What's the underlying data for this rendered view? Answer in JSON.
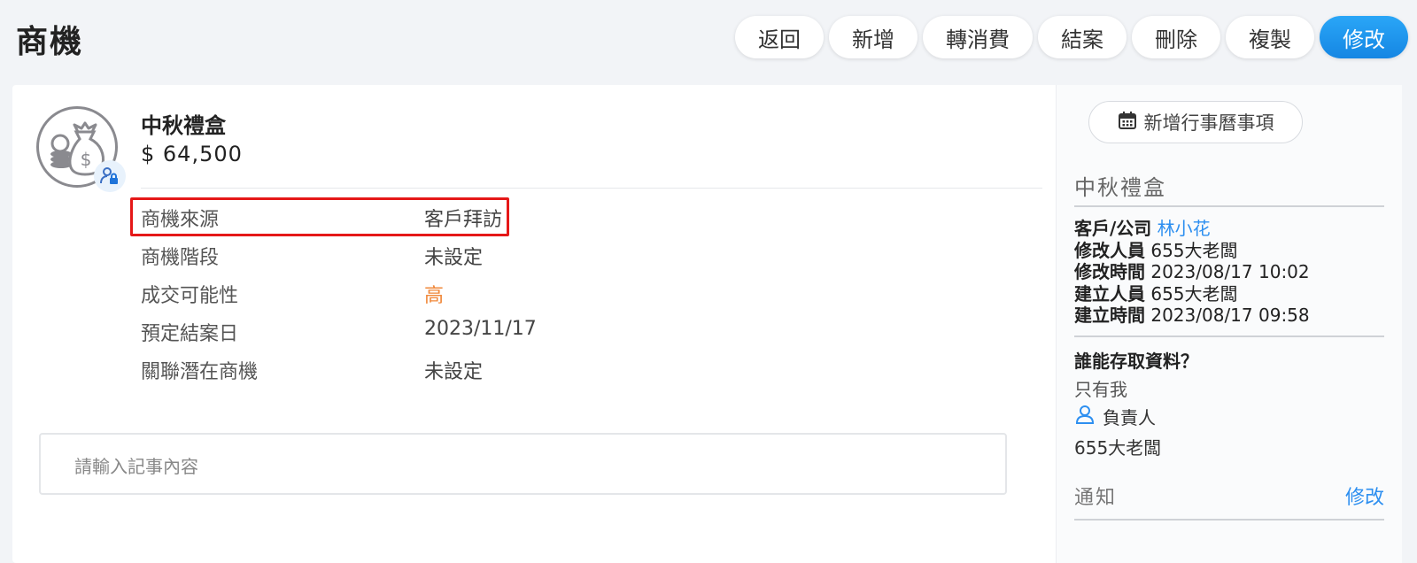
{
  "page": {
    "title": "商機"
  },
  "toolbar": {
    "buttons": [
      "返回",
      "新增",
      "轉消費",
      "結案",
      "刪除",
      "複製",
      "修改"
    ],
    "primary_color": "#1a8fe8"
  },
  "deal": {
    "name": "中秋禮盒",
    "amount": "$ 64,500",
    "fields": [
      {
        "label": "商機來源",
        "value": "客戶拜訪"
      },
      {
        "label": "商機階段",
        "value": "未設定"
      },
      {
        "label": "成交可能性",
        "value": "高"
      },
      {
        "label": "預定結案日",
        "value": "2023/11/17"
      },
      {
        "label": "關聯潛在商機",
        "value": "未設定"
      }
    ],
    "probability_color": "#f0883a"
  },
  "memo": {
    "placeholder": "請輸入記事內容"
  },
  "side": {
    "calendar_button": "新增行事曆事項",
    "title": "中秋禮盒",
    "customer_label": "客戶/公司",
    "customer_value": "林小花",
    "modified_by_label": "修改人員",
    "modified_by_value": "655大老闆",
    "modified_at_label": "修改時間",
    "modified_at_value": "2023/08/17 10:02",
    "created_by_label": "建立人員",
    "created_by_value": "655大老闆",
    "created_at_label": "建立時間",
    "created_at_value": "2023/08/17 09:58",
    "access_question": "誰能存取資料？",
    "access_answer": "只有我",
    "owner_label": "負責人",
    "owner_name": "655大老闆",
    "notify_title": "通知",
    "notify_edit": "修改",
    "link_color": "#2d8ff0"
  },
  "highlight_color": "#e51818"
}
